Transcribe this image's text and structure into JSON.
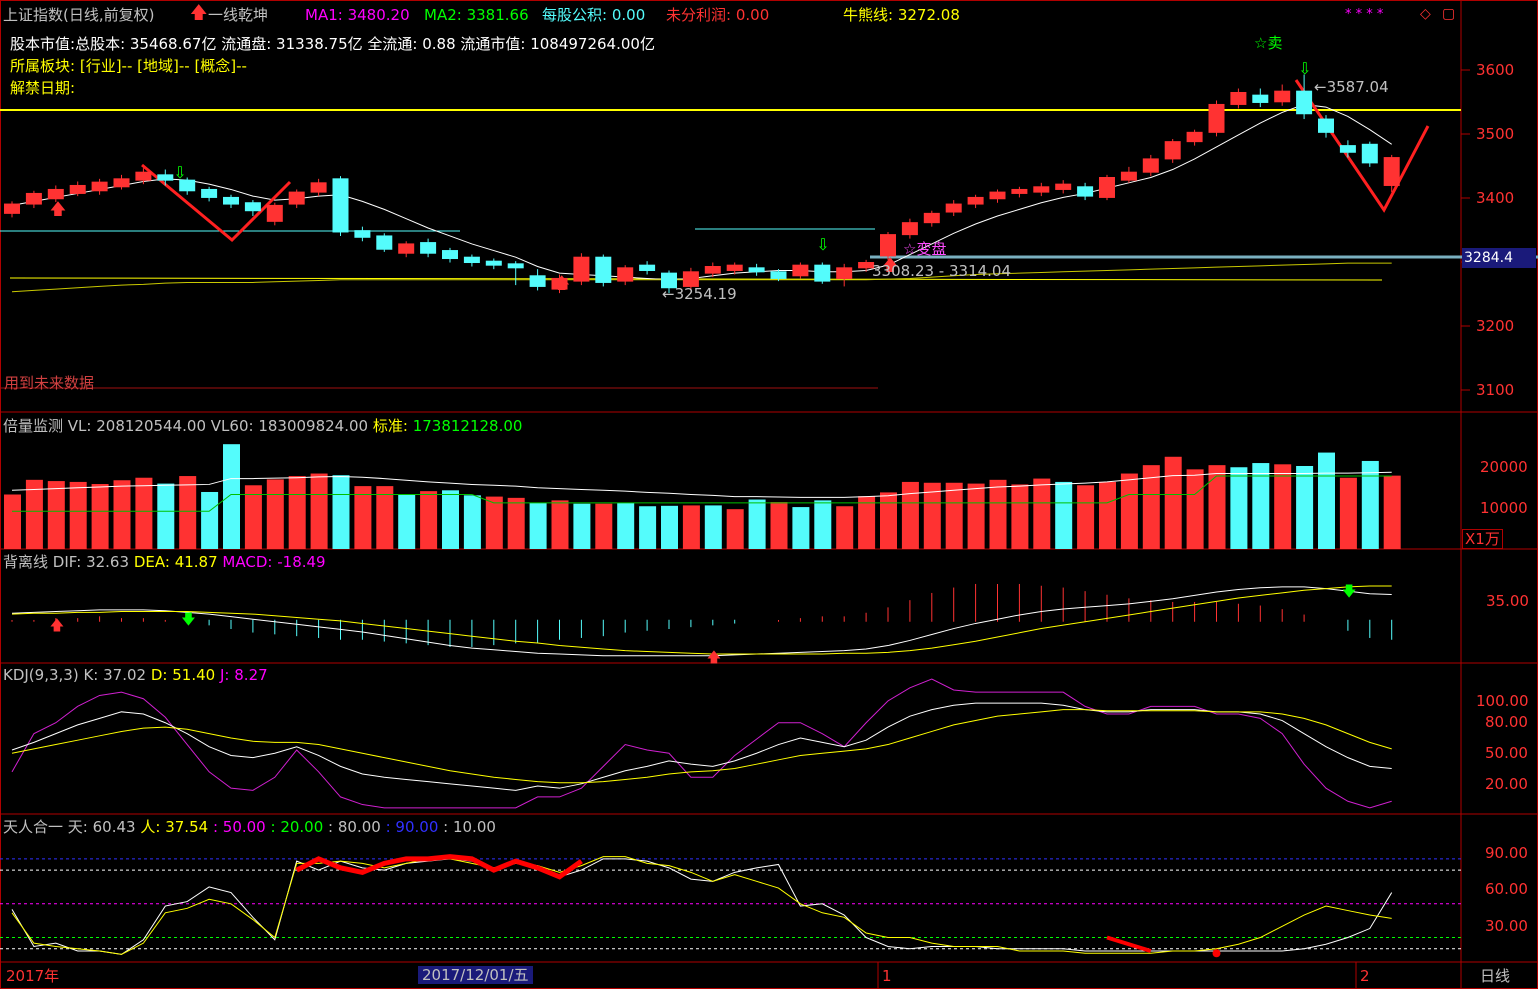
{
  "header": {
    "title": "上证指数(日线,前复权)",
    "indicator": "一线乾坤",
    "ma1_label": "MA1:",
    "ma1": "3480.20",
    "ma2_label": "MA2:",
    "ma2": "3381.66",
    "mgb_label": "每股公积:",
    "mgb": "0.00",
    "wfp_label": "未分利润:",
    "wfp": "0.00",
    "niu_label": "牛熊线:",
    "niu": "3272.08"
  },
  "info": {
    "line1_label": "股本市值:",
    "line1": "总股本: 35468.67亿 流通盘: 31338.75亿 全流通: 0.88 流通市值: 108497264.00亿",
    "line2_label": "所属板块:",
    "line2": "[行业]-- [地域]-- [概念]--",
    "line3_label": "解禁日期:"
  },
  "annotations": {
    "sell": "☆卖",
    "high": "3587.04",
    "low": "3254.19",
    "range": "3308.23 - 3314.04",
    "biandan": "变盘",
    "future": "用到未来数据",
    "price_tag": "3284.4"
  },
  "vol_header": {
    "name": "倍量监测",
    "vl_label": "VL:",
    "vl": "208120544.00",
    "vl60_label": "VL60:",
    "vl60": "183009824.00",
    "std_label": "标准:",
    "std": "173812128.00",
    "unit": "X1万"
  },
  "macd_header": {
    "name": "背离线",
    "dif_label": "DIF:",
    "dif": "32.63",
    "dea_label": "DEA:",
    "dea": "41.87",
    "macd_label": "MACD:",
    "macd": "-18.49"
  },
  "kdj_header": {
    "name": "KDJ(9,3,3)",
    "k_label": "K:",
    "k": "37.02",
    "d_label": "D:",
    "d": "51.40",
    "j_label": "J:",
    "j": "8.27"
  },
  "trh_header": {
    "name": "天人合一",
    "tian_label": "天:",
    "tian": "60.43",
    "ren_label": "人:",
    "ren": "37.54",
    "l50": ": 50.00",
    "l20": ": 20.00",
    "l80": ": 80.00",
    "l90": ": 90.00",
    "l10": ": 10.00"
  },
  "bottom": {
    "year": "2017年",
    "date": "2017/12/01/五",
    "m1": "1",
    "m2": "2",
    "period": "日线"
  },
  "axes": {
    "price_ticks": [
      "3600",
      "3500",
      "3400",
      "3300",
      "3200",
      "3100"
    ],
    "vol_ticks": [
      "20000",
      "10000"
    ],
    "macd_ticks": [
      "35.00"
    ],
    "kdj_ticks": [
      "100.00",
      "80.00",
      "50.00",
      "20.00"
    ],
    "trh_ticks": [
      "90.00",
      "60.00",
      "30.00"
    ]
  },
  "colors": {
    "up": "#ff3232",
    "down": "#54fcfc",
    "bg": "#000000",
    "yellow": "#ffff00",
    "white": "#ffffff",
    "magenta": "#ff00ff",
    "green": "#00ff00",
    "frame": "#b00000"
  },
  "chart_data": {
    "type": "candlestick",
    "price_ylim": [
      3100,
      3630
    ],
    "candles": [
      [
        3378,
        3392,
        3372,
        3396
      ],
      [
        3392,
        3408,
        3386,
        3412
      ],
      [
        3400,
        3414,
        3395,
        3420
      ],
      [
        3408,
        3420,
        3404,
        3426
      ],
      [
        3412,
        3425,
        3406,
        3430
      ],
      [
        3418,
        3430,
        3414,
        3436
      ],
      [
        3428,
        3440,
        3422,
        3446
      ],
      [
        3436,
        3428,
        3420,
        3444
      ],
      [
        3428,
        3412,
        3406,
        3432
      ],
      [
        3414,
        3402,
        3396,
        3418
      ],
      [
        3402,
        3392,
        3386,
        3406
      ],
      [
        3394,
        3382,
        3374,
        3398
      ],
      [
        3366,
        3390,
        3360,
        3394
      ],
      [
        3392,
        3410,
        3386,
        3414
      ],
      [
        3410,
        3424,
        3404,
        3430
      ],
      [
        3430,
        3350,
        3344,
        3434
      ],
      [
        3352,
        3342,
        3336,
        3358
      ],
      [
        3344,
        3324,
        3320,
        3348
      ],
      [
        3318,
        3332,
        3312,
        3336
      ],
      [
        3334,
        3318,
        3312,
        3340
      ],
      [
        3322,
        3310,
        3304,
        3326
      ],
      [
        3312,
        3304,
        3298,
        3316
      ],
      [
        3306,
        3300,
        3294,
        3310
      ],
      [
        3302,
        3296,
        3270,
        3306
      ],
      [
        3284,
        3268,
        3262,
        3294
      ],
      [
        3264,
        3280,
        3258,
        3286
      ],
      [
        3276,
        3312,
        3270,
        3318
      ],
      [
        3312,
        3274,
        3268,
        3316
      ],
      [
        3276,
        3296,
        3270,
        3300
      ],
      [
        3300,
        3292,
        3286,
        3306
      ],
      [
        3288,
        3266,
        3258,
        3292
      ],
      [
        3268,
        3290,
        3262,
        3296
      ],
      [
        3288,
        3298,
        3282,
        3304
      ],
      [
        3292,
        3300,
        3286,
        3304
      ],
      [
        3296,
        3290,
        3284,
        3302
      ],
      [
        3290,
        3280,
        3276,
        3294
      ],
      [
        3284,
        3300,
        3280,
        3304
      ],
      [
        3300,
        3276,
        3272,
        3304
      ],
      [
        3280,
        3296,
        3268,
        3302
      ],
      [
        3296,
        3304,
        3290,
        3308
      ],
      [
        3314,
        3346,
        3308,
        3350
      ],
      [
        3346,
        3364,
        3340,
        3370
      ],
      [
        3364,
        3378,
        3358,
        3382
      ],
      [
        3380,
        3392,
        3374,
        3398
      ],
      [
        3392,
        3402,
        3386,
        3406
      ],
      [
        3400,
        3410,
        3394,
        3414
      ],
      [
        3408,
        3414,
        3402,
        3418
      ],
      [
        3410,
        3418,
        3404,
        3424
      ],
      [
        3414,
        3422,
        3408,
        3428
      ],
      [
        3418,
        3404,
        3398,
        3424
      ],
      [
        3402,
        3432,
        3398,
        3436
      ],
      [
        3428,
        3440,
        3424,
        3448
      ],
      [
        3440,
        3460,
        3434,
        3466
      ],
      [
        3460,
        3486,
        3454,
        3490
      ],
      [
        3486,
        3500,
        3480,
        3504
      ],
      [
        3500,
        3542,
        3494,
        3548
      ],
      [
        3542,
        3560,
        3536,
        3566
      ],
      [
        3556,
        3545,
        3538,
        3566
      ],
      [
        3546,
        3562,
        3540,
        3572
      ],
      [
        3562,
        3528,
        3520,
        3587
      ],
      [
        3520,
        3500,
        3492,
        3526
      ],
      [
        3480,
        3470,
        3462,
        3488
      ],
      [
        3482,
        3454,
        3448,
        3486
      ],
      [
        3420,
        3462,
        3410,
        3466
      ]
    ],
    "ma1": [
      3390,
      3396,
      3402,
      3408,
      3414,
      3420,
      3426,
      3430,
      3428,
      3422,
      3414,
      3404,
      3398,
      3400,
      3404,
      3406,
      3396,
      3384,
      3370,
      3356,
      3344,
      3332,
      3322,
      3312,
      3298,
      3288,
      3286,
      3284,
      3282,
      3280,
      3278,
      3280,
      3284,
      3288,
      3290,
      3292,
      3292,
      3290,
      3290,
      3292,
      3300,
      3316,
      3332,
      3348,
      3362,
      3374,
      3384,
      3394,
      3402,
      3408,
      3416,
      3424,
      3432,
      3444,
      3460,
      3478,
      3496,
      3514,
      3530,
      3542,
      3538,
      3524,
      3504,
      3482
    ],
    "ma2": [
      3350,
      3352,
      3354,
      3356,
      3358,
      3360,
      3361,
      3363,
      3364,
      3364,
      3364,
      3364,
      3365,
      3366,
      3367,
      3368,
      3368,
      3368,
      3368,
      3368,
      3368,
      3368,
      3368,
      3368,
      3368,
      3368,
      3368,
      3368,
      3368,
      3368,
      3368,
      3368,
      3368,
      3368,
      3368,
      3368,
      3368,
      3368,
      3368,
      3368,
      3369,
      3370,
      3372,
      3374,
      3376,
      3377,
      3378,
      3379,
      3380,
      3381,
      3382,
      3383,
      3384,
      3385,
      3386,
      3387,
      3388,
      3389,
      3390,
      3391,
      3392,
      3393,
      3393,
      3393
    ],
    "volume": [
      13000,
      16500,
      16200,
      16000,
      15500,
      16400,
      17000,
      15600,
      17400,
      13600,
      25000,
      15200,
      16600,
      17400,
      18000,
      17600,
      15000,
      15000,
      13000,
      13800,
      14000,
      12800,
      12500,
      12200,
      11000,
      11600,
      10800,
      10800,
      11000,
      10200,
      10300,
      10400,
      10400,
      9500,
      11800,
      11200,
      10000,
      11600,
      10200,
      12600,
      13500,
      16000,
      15800,
      15800,
      15600,
      16500,
      15400,
      16800,
      16000,
      15200,
      16000,
      18000,
      20000,
      22000,
      19000,
      20000,
      19500,
      20500,
      20200,
      19800,
      23000,
      17000,
      21000,
      17500
    ],
    "vol_up": [
      true,
      true,
      true,
      true,
      true,
      true,
      true,
      false,
      true,
      false,
      false,
      true,
      true,
      true,
      true,
      false,
      true,
      true,
      false,
      true,
      false,
      false,
      true,
      true,
      false,
      true,
      false,
      true,
      false,
      false,
      false,
      true,
      false,
      true,
      false,
      true,
      false,
      false,
      true,
      true,
      true,
      true,
      true,
      true,
      true,
      true,
      true,
      true,
      false,
      true,
      true,
      true,
      true,
      true,
      true,
      true,
      false,
      false,
      true,
      false,
      false,
      true,
      false,
      true
    ],
    "vol_line": [
      14000,
      14200,
      14400,
      14600,
      14800,
      15000,
      15100,
      15200,
      15300,
      15400,
      16800,
      16800,
      16900,
      17000,
      17200,
      17300,
      17100,
      16800,
      16400,
      16000,
      15700,
      15400,
      15200,
      15000,
      14600,
      14400,
      14200,
      14000,
      13800,
      13500,
      13300,
      13000,
      12800,
      12500,
      12500,
      12400,
      12300,
      12300,
      12300,
      12500,
      12700,
      13200,
      13600,
      14000,
      14400,
      14800,
      15000,
      15300,
      15500,
      15700,
      16000,
      16500,
      17000,
      17500,
      17600,
      18000,
      18000,
      18000,
      18000,
      18000,
      18100,
      18100,
      18200,
      18300
    ],
    "vol_line2": [
      9000,
      9000,
      9000,
      9000,
      9000,
      9000,
      9000,
      9000,
      9000,
      9000,
      13000,
      13000,
      13000,
      13000,
      13000,
      13000,
      13000,
      13000,
      13000,
      13000,
      13000,
      13000,
      11000,
      11000,
      11000,
      11000,
      11000,
      11000,
      11000,
      11000,
      11000,
      11000,
      11000,
      11000,
      11000,
      11000,
      11000,
      11000,
      11000,
      11000,
      11000,
      11000,
      11000,
      11000,
      11000,
      11000,
      11000,
      11000,
      11000,
      11000,
      11000,
      13000,
      13000,
      13000,
      13000,
      17400,
      17400,
      17400,
      17400,
      17400,
      17400,
      17400,
      17400,
      17400
    ],
    "dif": [
      10,
      11,
      12,
      13,
      14,
      14,
      14,
      13,
      11,
      9,
      6,
      3,
      0,
      -3,
      -6,
      -9,
      -12,
      -16,
      -20,
      -24,
      -28,
      -31,
      -33,
      -35,
      -37,
      -38,
      -39,
      -40,
      -40,
      -40,
      -40,
      -40,
      -40,
      -39,
      -38,
      -37,
      -36,
      -35,
      -34,
      -32,
      -28,
      -22,
      -15,
      -8,
      -2,
      3,
      8,
      12,
      15,
      17,
      19,
      21,
      24,
      27,
      31,
      35,
      38,
      40,
      41,
      41,
      39,
      36,
      33,
      32
    ],
    "dea": [
      9,
      10,
      10,
      11,
      11,
      12,
      12,
      12,
      12,
      11,
      10,
      9,
      7,
      5,
      3,
      1,
      -2,
      -5,
      -8,
      -11,
      -14,
      -17,
      -20,
      -23,
      -25,
      -28,
      -30,
      -32,
      -34,
      -35,
      -36,
      -37,
      -38,
      -38,
      -38,
      -38,
      -38,
      -38,
      -37,
      -37,
      -36,
      -34,
      -31,
      -27,
      -23,
      -18,
      -13,
      -8,
      -4,
      0,
      4,
      8,
      12,
      16,
      20,
      24,
      28,
      31,
      34,
      37,
      39,
      41,
      42,
      42
    ],
    "macd_ylim": [
      -45,
      55
    ],
    "kdj_ylim": [
      0,
      110
    ],
    "k": [
      55,
      62,
      70,
      78,
      84,
      90,
      88,
      80,
      70,
      58,
      50,
      48,
      52,
      58,
      50,
      40,
      33,
      30,
      28,
      26,
      24,
      22,
      20,
      18,
      22,
      20,
      24,
      30,
      36,
      40,
      45,
      42,
      40,
      45,
      52,
      60,
      66,
      62,
      58,
      64,
      76,
      86,
      92,
      96,
      98,
      98,
      98,
      98,
      96,
      92,
      90,
      90,
      92,
      92,
      92,
      90,
      90,
      88,
      82,
      70,
      58,
      48,
      40,
      38
    ],
    "d": [
      52,
      56,
      60,
      64,
      68,
      72,
      75,
      76,
      74,
      70,
      66,
      63,
      62,
      62,
      60,
      56,
      52,
      48,
      44,
      40,
      36,
      33,
      30,
      28,
      26,
      25,
      25,
      26,
      28,
      30,
      33,
      35,
      36,
      38,
      42,
      46,
      50,
      52,
      54,
      56,
      60,
      66,
      72,
      78,
      82,
      86,
      88,
      90,
      92,
      92,
      91,
      91,
      91,
      91,
      91,
      90,
      90,
      90,
      88,
      84,
      78,
      70,
      62,
      56
    ],
    "j": [
      35,
      70,
      80,
      95,
      105,
      108,
      102,
      85,
      60,
      35,
      20,
      18,
      30,
      55,
      35,
      12,
      5,
      2,
      2,
      2,
      2,
      2,
      2,
      2,
      12,
      12,
      20,
      40,
      60,
      55,
      52,
      30,
      30,
      50,
      65,
      80,
      80,
      70,
      58,
      80,
      100,
      112,
      120,
      110,
      108,
      108,
      108,
      108,
      108,
      95,
      88,
      88,
      95,
      95,
      95,
      88,
      88,
      84,
      70,
      42,
      20,
      8,
      2,
      8
    ],
    "tian": [
      45,
      12,
      15,
      8,
      8,
      5,
      18,
      48,
      52,
      65,
      60,
      38,
      18,
      88,
      80,
      88,
      82,
      80,
      86,
      88,
      90,
      88,
      82,
      86,
      84,
      74,
      80,
      90,
      90,
      88,
      82,
      72,
      70,
      78,
      82,
      85,
      48,
      50,
      40,
      20,
      12,
      10,
      12,
      12,
      12,
      10,
      10,
      10,
      10,
      8,
      8,
      8,
      8,
      8,
      8,
      8,
      8,
      8,
      8,
      10,
      14,
      20,
      28,
      60
    ],
    "ren": [
      42,
      15,
      12,
      10,
      8,
      5,
      15,
      42,
      46,
      54,
      50,
      36,
      20,
      86,
      86,
      88,
      86,
      82,
      86,
      90,
      90,
      86,
      82,
      86,
      84,
      78,
      84,
      92,
      92,
      86,
      84,
      78,
      70,
      76,
      70,
      64,
      50,
      42,
      38,
      24,
      20,
      20,
      15,
      12,
      12,
      12,
      8,
      8,
      8,
      6,
      6,
      6,
      6,
      8,
      8,
      10,
      14,
      20,
      30,
      40,
      48,
      44,
      40,
      37
    ],
    "trh_red": [
      [
        13,
        80
      ],
      [
        14,
        90
      ],
      [
        15,
        82
      ],
      [
        16,
        78
      ],
      [
        17,
        86
      ],
      [
        18,
        90
      ],
      [
        19,
        90
      ],
      [
        20,
        92
      ],
      [
        21,
        90
      ],
      [
        22,
        80
      ],
      [
        23,
        88
      ],
      [
        24,
        82
      ],
      [
        25,
        74
      ],
      [
        26,
        88
      ]
    ],
    "trh_red2": [
      [
        50,
        20
      ],
      [
        51,
        14
      ],
      [
        52,
        8
      ]
    ],
    "trh_ylim": [
      0,
      105
    ]
  }
}
